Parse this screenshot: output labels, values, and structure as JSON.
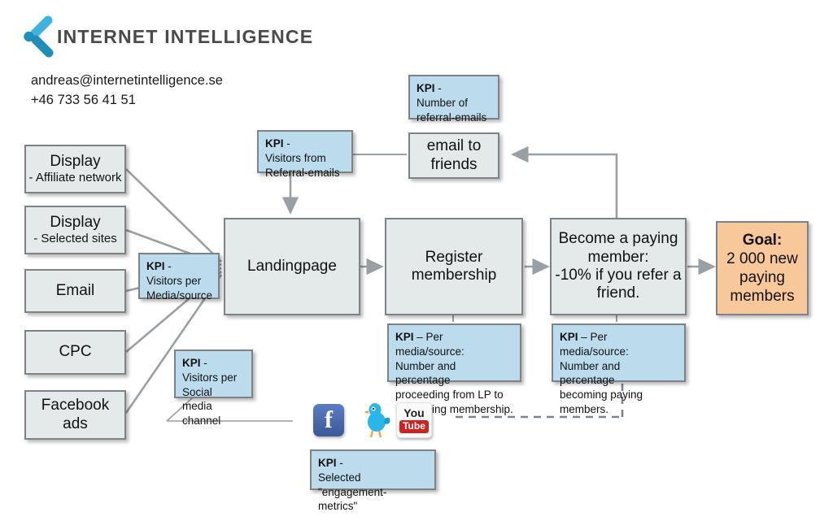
{
  "header": {
    "brand": "INTERNET INTELLIGENCE",
    "email": "andreas@internetintelligence.se",
    "phone": "+46 733 56 41 51",
    "logo_icon": "internet-intelligence-logo"
  },
  "colors": {
    "process_fill": "#e4eaea",
    "kpi_fill": "#bcdcee",
    "goal_fill": "#f9c89a",
    "border": "#7c8287",
    "connector": "#9a9fa3",
    "brand_blue": "#2aa3cf",
    "brand_text": "#4a4a4a"
  },
  "channels": [
    {
      "title": "Display",
      "subtitle": "- Affiliate network"
    },
    {
      "title": "Display",
      "subtitle": "- Selected sites"
    },
    {
      "title": "Email",
      "subtitle": ""
    },
    {
      "title": "CPC",
      "subtitle": ""
    },
    {
      "title": "Facebook",
      "subtitle": "ads",
      "two_line": true
    }
  ],
  "flow": {
    "landingpage": "Landingpage",
    "register": "Register\nmembership",
    "register_l1": "Register",
    "register_l2": "membership",
    "paying_l1": "Become a paying",
    "paying_l2": "member:",
    "paying_l3": "-10% if you refer a",
    "paying_l4": "friend.",
    "email_to_friends_l1": "email to",
    "email_to_friends_l2": "friends",
    "goal_l1": "Goal:",
    "goal_l2": "2 000 new",
    "goal_l3": "paying",
    "goal_l4": "members"
  },
  "kpis": {
    "media_source": {
      "label": "KPI",
      "dash": "-",
      "lines": [
        "Visitors per",
        "Media/source"
      ]
    },
    "social_channel": {
      "label": "KPI",
      "dash": "-",
      "lines": [
        "Visitors per",
        "Social media",
        "channel"
      ]
    },
    "referral_visitors": {
      "label": "KPI",
      "dash": "-",
      "lines": [
        "Visitors from",
        "Referral-emails"
      ]
    },
    "referral_count": {
      "label": "KPI",
      "dash": "-",
      "lines": [
        "Number of",
        "referral-emails"
      ]
    },
    "lp_to_register": {
      "label": "KPI",
      "dash": "– Per media/source:",
      "lines": [
        "Number and percentage",
        "proceeding from LP to",
        "registering membership."
      ]
    },
    "to_paying": {
      "label": "KPI",
      "dash": "– Per media/source:",
      "lines": [
        "Number and percentage",
        "becoming paying",
        "members."
      ]
    },
    "engagement": {
      "label": "KPI",
      "dash": "-",
      "lines": [
        "Selected \"engagement-",
        "metrics\""
      ]
    }
  },
  "social": [
    {
      "name": "facebook-icon",
      "letter": "f"
    },
    {
      "name": "twitter-icon",
      "letter": ""
    },
    {
      "name": "youtube-icon",
      "you": "You",
      "tube": "Tube"
    }
  ]
}
